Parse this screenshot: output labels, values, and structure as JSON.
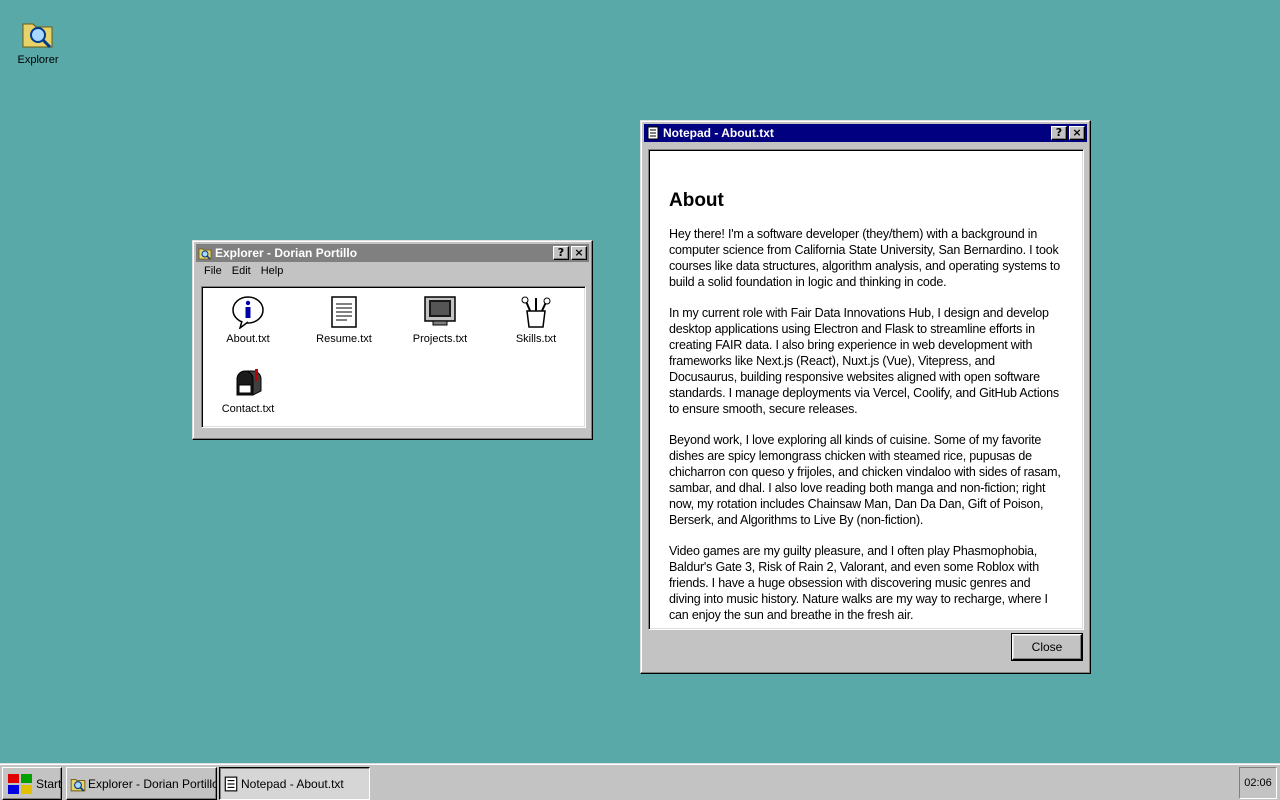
{
  "desktop": {
    "icons": [
      {
        "label": "Explorer",
        "icon": "explorer-folder-icon"
      }
    ]
  },
  "explorer_window": {
    "title": "Explorer - Dorian Portillo",
    "menu": [
      "File",
      "Edit",
      "Help"
    ],
    "files": [
      {
        "label": "About.txt",
        "icon": "info-balloon-icon"
      },
      {
        "label": "Resume.txt",
        "icon": "document-icon"
      },
      {
        "label": "Projects.txt",
        "icon": "monitor-icon"
      },
      {
        "label": "Skills.txt",
        "icon": "tools-cup-icon"
      },
      {
        "label": "Contact.txt",
        "icon": "mailbox-icon"
      }
    ]
  },
  "notepad_window": {
    "title": "Notepad - About.txt",
    "heading": "About",
    "paragraphs": [
      "Hey there! I'm a software developer (they/them) with a background in computer science from California State University, San Bernardino. I took courses like data structures, algorithm analysis, and operating systems to build a solid foundation in logic and thinking in code.",
      "In my current role with Fair Data Innovations Hub, I design and develop desktop applications using Electron and Flask to streamline efforts in creating FAIR data. I also bring experience in web development with frameworks like Next.js (React), Nuxt.js (Vue), Vitepress, and Docusaurus, building responsive websites aligned with open software standards. I manage deployments via Vercel, Coolify, and GitHub Actions to ensure smooth, secure releases.",
      "Beyond work, I love exploring all kinds of cuisine. Some of my favorite dishes are spicy lemongrass chicken with steamed rice, pupusas de chicharron con queso y frijoles, and chicken vindaloo with sides of rasam, sambar, and dhal. I also love reading both manga and non-fiction; right now, my rotation includes Chainsaw Man, Dan Da Dan, Gift of Poison, Berserk, and Algorithms to Live By (non-fiction).",
      "Video games are my guilty pleasure, and I often play Phasmophobia, Baldur's Gate 3, Risk of Rain 2, Valorant, and even some Roblox with friends. I have a huge obsession with discovering music genres and diving into music history. Nature walks are my way to recharge, where I can enjoy the sun and breathe in the fresh air."
    ],
    "close_label": "Close"
  },
  "title_buttons": {
    "help": "?",
    "close": "×"
  },
  "taskbar": {
    "start_label": "Start",
    "tasks": [
      {
        "label": "Explorer - Dorian Portillo"
      },
      {
        "label": "Notepad - About.txt"
      }
    ],
    "clock": "02:06"
  }
}
